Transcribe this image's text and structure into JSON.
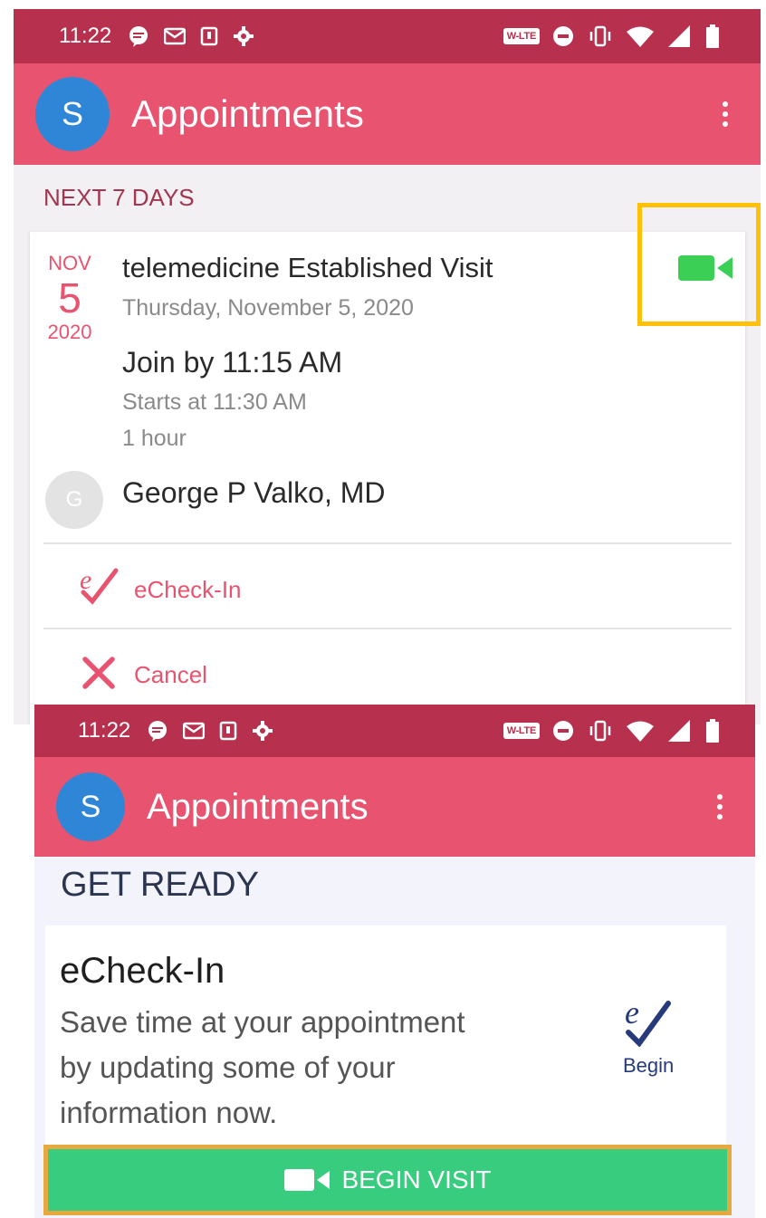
{
  "top_screen": {
    "status_bar": {
      "time": "11:22",
      "network_badge": "W-LTE"
    },
    "app_bar": {
      "avatar_letter": "S",
      "title": "Appointments"
    },
    "section_label": "NEXT 7 DAYS",
    "appointment": {
      "date": {
        "month": "NOV",
        "day": "5",
        "year": "2020"
      },
      "title": "telemedicine Established Visit",
      "date_text": "Thursday, November 5, 2020",
      "join_by": "Join by 11:15 AM",
      "starts_at": "Starts at 11:30 AM",
      "duration": "1 hour",
      "provider_initial": "G",
      "provider_name": "George P Valko, MD"
    },
    "actions": [
      {
        "label": "eCheck-In",
        "icon": "echeckin-icon"
      },
      {
        "label": "Cancel",
        "icon": "close-icon"
      }
    ]
  },
  "bottom_screen": {
    "status_bar": {
      "time": "11:22",
      "network_badge": "W-LTE"
    },
    "app_bar": {
      "avatar_letter": "S",
      "title": "Appointments"
    },
    "section_label": "GET READY",
    "echeckin_card": {
      "title": "eCheck-In",
      "line1": "Save time at your appointment",
      "line2": "by updating some of your",
      "line3": "information now.",
      "begin_label": "Begin"
    },
    "begin_visit_label": "BEGIN VISIT"
  },
  "colors": {
    "status_bar": "#b7314f",
    "app_bar": "#e8546f",
    "avatar": "#2f86d6",
    "accent_pink": "#e8546f",
    "video_green": "#3ccf55",
    "begin_visit_green": "#38cc7e",
    "highlight_yellow": "#ffc107",
    "echeckin_navy": "#273a7c"
  }
}
